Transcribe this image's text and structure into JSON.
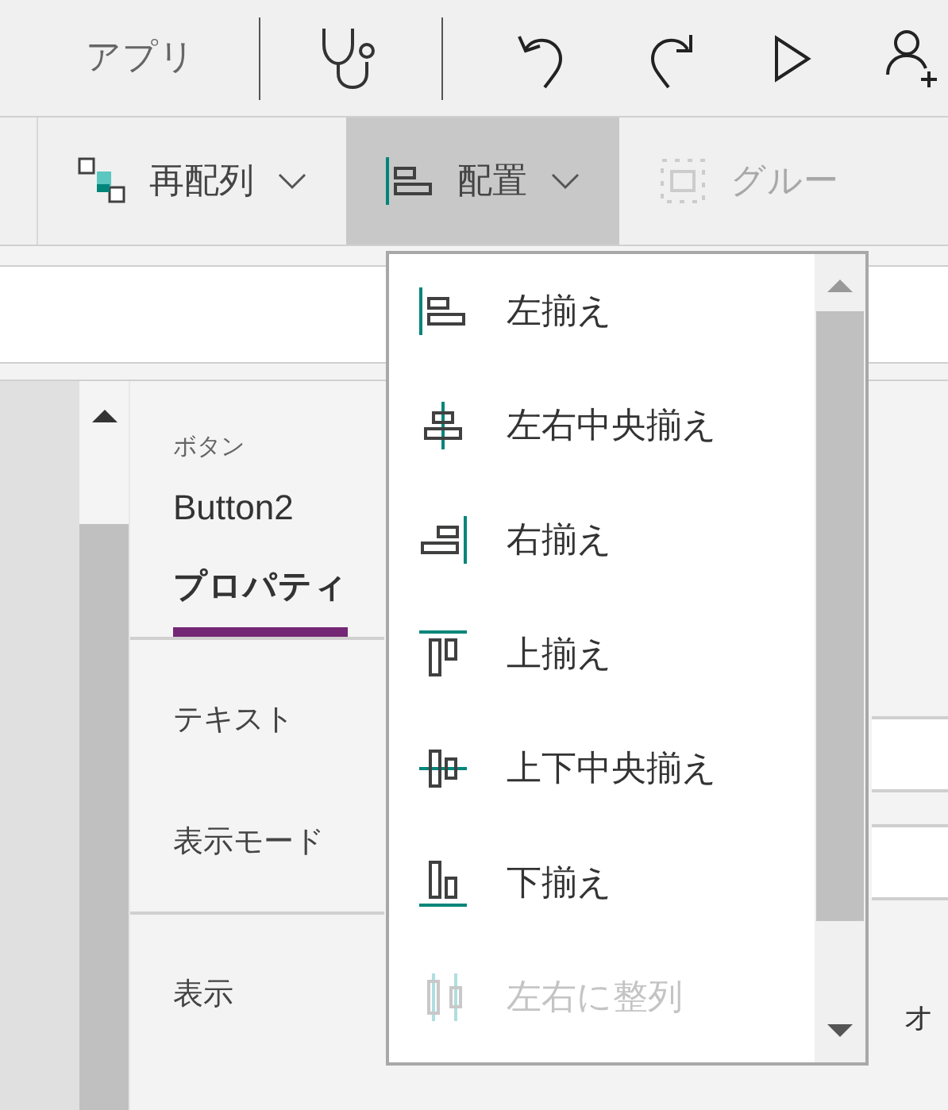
{
  "top_bar": {
    "app_label": "アプリ"
  },
  "toolbar": {
    "buttons": [
      {
        "label": "再配列",
        "kind": "reorder",
        "selected": false,
        "disabled": false
      },
      {
        "label": "配置",
        "kind": "align",
        "selected": true,
        "disabled": false
      },
      {
        "label": "グルー",
        "kind": "group",
        "selected": false,
        "disabled": true
      }
    ]
  },
  "properties": {
    "type": "ボタン",
    "name": "Button2",
    "tab": "プロパティ",
    "rows": [
      {
        "label": "テキスト"
      },
      {
        "label": "表示モード"
      },
      {
        "label": "表示",
        "value": "オ"
      }
    ]
  },
  "align_menu": {
    "items": [
      {
        "label": "左揃え",
        "kind": "left",
        "disabled": false
      },
      {
        "label": "左右中央揃え",
        "kind": "center",
        "disabled": false
      },
      {
        "label": "右揃え",
        "kind": "right",
        "disabled": false
      },
      {
        "label": "上揃え",
        "kind": "top",
        "disabled": false
      },
      {
        "label": "上下中央揃え",
        "kind": "middle",
        "disabled": false
      },
      {
        "label": "下揃え",
        "kind": "bottom",
        "disabled": false
      },
      {
        "label": "左右に整列",
        "kind": "distribute",
        "disabled": true
      }
    ]
  }
}
